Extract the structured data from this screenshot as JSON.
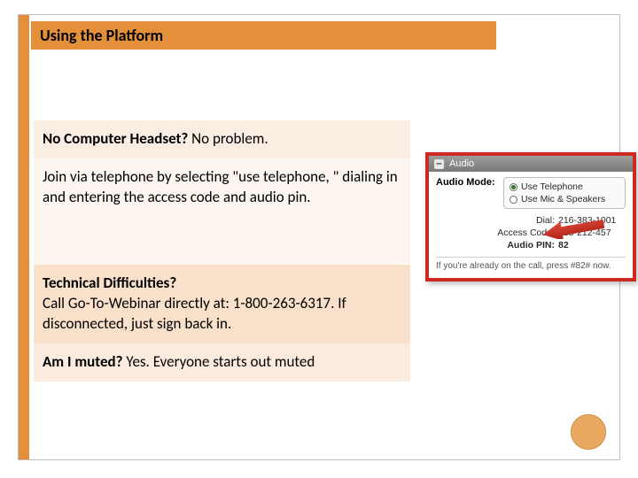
{
  "header": {
    "title": "Using the Platform"
  },
  "blocks": {
    "q1_bold": "No  Computer Headset?",
    "q1_rest": " No problem.",
    "instruction": "Join via telephone by selecting \"use telephone, \" dialing in and entering the  access code and audio pin.",
    "tech_bold": "Technical Difficulties?",
    "tech_rest": "Call Go-To-Webinar directly at:  1-800-263-6317. If disconnected, just sign back in.",
    "muted_bold": "Am I muted?",
    "muted_rest": " Yes. Everyone starts out muted"
  },
  "audioPanel": {
    "headerTitle": "Audio",
    "modeLabel": "Audio Mode:",
    "optionTelephone": "Use Telephone",
    "optionMicSpeakers": "Use Mic & Speakers",
    "dialLabel": "Dial:",
    "dialValue": "216-383-1001",
    "accessLabel": "Access Code:",
    "accessValue": "338-212-457",
    "pinLabel": "Audio PIN:",
    "pinValue": "82",
    "footerNote": "If you're already on the call, press #82# now."
  }
}
